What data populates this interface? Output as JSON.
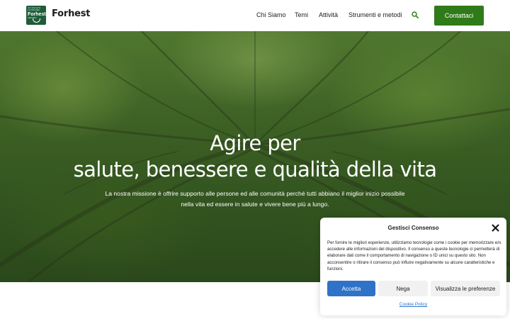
{
  "header": {
    "logo_lines": [
      "UN SOLUTO",
      "LA NATURA"
    ],
    "logo_name": "Forhest",
    "logo_sub": "CENTRO",
    "brand": "Forhest",
    "nav": [
      "Chi Siamo",
      "Temi",
      "Attività",
      "Strumenti e metodi"
    ],
    "search_icon": "search-icon",
    "cta_label": "Contattaci"
  },
  "hero": {
    "title_line1": "Agire per",
    "title_line2": "salute, benessere e qualità della vita",
    "desc_line1": "La nostra missione è offrire supporto alle persone ed alle comunità perché tutti abbiano il miglior inizio possibile",
    "desc_line2": "nella vita ed essere in salute e vivere bene più a lungo."
  },
  "cookie": {
    "title": "Gestisci Consenso",
    "close_icon": "close-icon",
    "text": "Per fornire le migliori esperienze, utilizziamo tecnologie come i cookie per memorizzare e/o accedere alle informazioni del dispositivo. Il consenso a queste tecnologie ci permetterà di elaborare dati come il comportamento di navigazione o ID unici su questo sito. Non acconsentire o ritirare il consenso può influire negativamente su alcune caratteristiche e funzioni.",
    "accept": "Accetta",
    "deny": "Nega",
    "prefs": "Visualizza le preferenze",
    "policy": "Cookie Policy"
  },
  "colors": {
    "brand_green": "#2f7a19",
    "accept_blue": "#2e73c8"
  }
}
